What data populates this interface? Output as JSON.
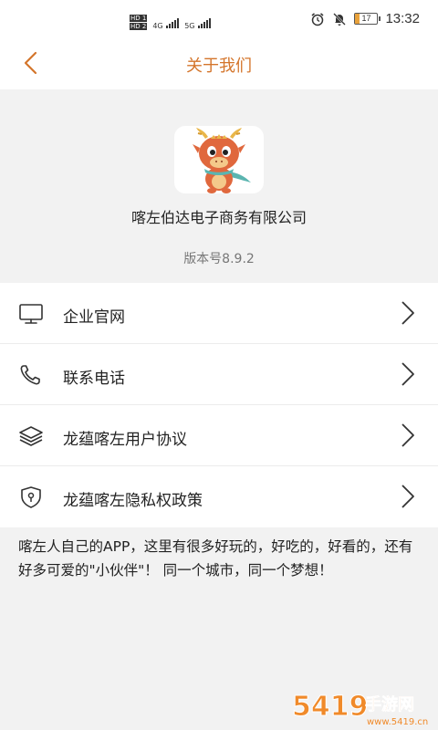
{
  "status_bar": {
    "hd1": "HD 1",
    "hd2": "HD 2",
    "net1": "4G",
    "net2": "5G",
    "battery": "17",
    "battery_level": 0.17,
    "time": "13:32"
  },
  "header": {
    "title": "关于我们"
  },
  "about": {
    "company_name": "喀左伯达电子商务有限公司",
    "version": "版本号8.9.2"
  },
  "menu": {
    "items": [
      {
        "label": "企业官网",
        "icon": "monitor-icon"
      },
      {
        "label": "联系电话",
        "icon": "phone-icon"
      },
      {
        "label": "龙蕴喀左用户协议",
        "icon": "layers-icon"
      },
      {
        "label": "龙蕴喀左隐私权政策",
        "icon": "shield-icon"
      }
    ]
  },
  "intro": {
    "text": "喀左人自己的APP，这里有很多好玩的，好吃的，好看的，还有好多可爱的\"小伙伴\"！ 同一个城市，同一个梦想！"
  },
  "watermark": {
    "text": "5419手游网",
    "domain": "www.5419.cn"
  },
  "colors": {
    "accent": "#d4752b",
    "background": "#f2f2f2"
  }
}
